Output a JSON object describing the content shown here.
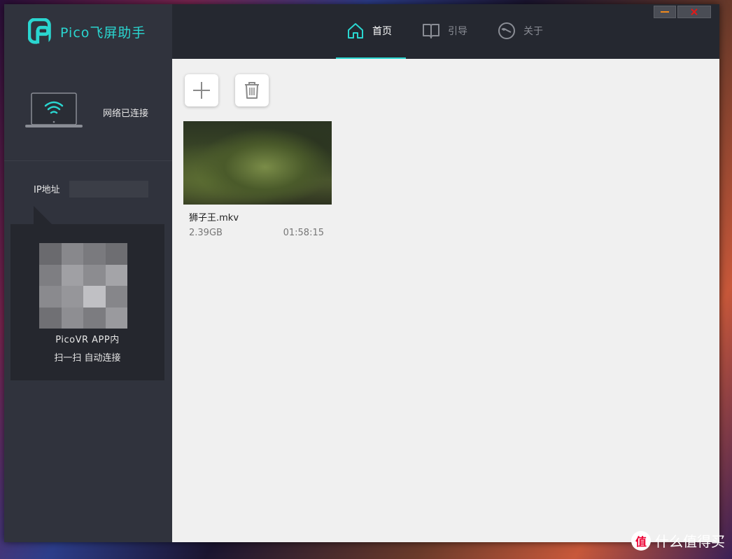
{
  "app": {
    "name": "Pico飞屏助手"
  },
  "nav": {
    "tabs": [
      {
        "label": "首页",
        "active": true,
        "icon": "home-icon"
      },
      {
        "label": "引导",
        "active": false,
        "icon": "book-icon"
      },
      {
        "label": "关于",
        "active": false,
        "icon": "about-icon"
      }
    ]
  },
  "colors": {
    "accent": "#2ad6d0",
    "sidebar": "#30333d",
    "titlebar": "#252830",
    "content": "#f0f0f0"
  },
  "sidebar": {
    "connection_status": "网络已连接",
    "ip_label": "IP地址",
    "qr_line1": "PicoVR APP内",
    "qr_line2": "扫一扫 自动连接"
  },
  "toolbar": {
    "add_icon": "plus-icon",
    "delete_icon": "trash-icon"
  },
  "files": [
    {
      "name": "狮子王.mkv",
      "size": "2.39GB",
      "duration": "01:58:15"
    }
  ],
  "watermark": {
    "text": "什么值得买",
    "badge": "值"
  }
}
